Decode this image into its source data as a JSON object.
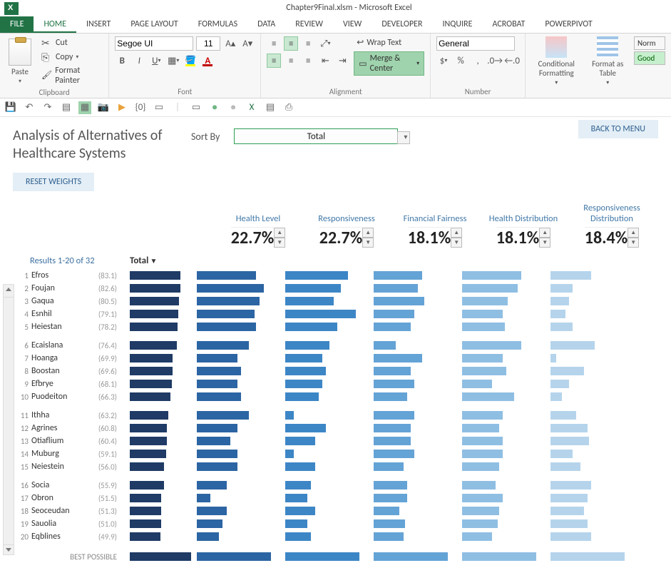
{
  "app": {
    "title": "Chapter9Final.xlsm - Microsoft Excel"
  },
  "tabs": {
    "file": "FILE",
    "home": "HOME",
    "insert": "INSERT",
    "page_layout": "PAGE LAYOUT",
    "formulas": "FORMULAS",
    "data": "DATA",
    "review": "REVIEW",
    "view": "VIEW",
    "developer": "DEVELOPER",
    "inquire": "INQUIRE",
    "acrobat": "ACROBAT",
    "powerpivot": "POWERPIVOT"
  },
  "ribbon": {
    "clipboard": {
      "paste": "Paste",
      "cut": "Cut",
      "copy": "Copy",
      "format_painter": "Format Painter",
      "label": "Clipboard"
    },
    "font": {
      "name": "Segoe UI",
      "size": "11",
      "label": "Font"
    },
    "alignment": {
      "wrap": "Wrap Text",
      "merge": "Merge & Center",
      "label": "Alignment"
    },
    "number": {
      "format": "General",
      "label": "Number"
    },
    "styles": {
      "cond": "Conditional Formatting",
      "table": "Format as Table",
      "norm": "Norm",
      "good": "Good"
    }
  },
  "sheet": {
    "title_l1": "Analysis of Alternatives of",
    "title_l2": "Healthcare Systems",
    "sort_label": "Sort By",
    "sort_value": "Total",
    "back": "BACK TO MENU",
    "reset": "RESET WEIGHTS",
    "results_label": "Results 1-20 of 32",
    "total_label": "Total",
    "best": "BEST POSSIBLE"
  },
  "criteria": [
    {
      "name": "Health Level",
      "weight": "22.7%"
    },
    {
      "name": "Responsiveness",
      "weight": "22.7%"
    },
    {
      "name": "Financial Fairness",
      "weight": "18.1%"
    },
    {
      "name": "Health Distribution",
      "weight": "18.1%"
    },
    {
      "name": "Responsiveness Distribution",
      "weight": "18.4%"
    }
  ],
  "chart_data": {
    "type": "bar",
    "note": "Horizontal bars per alternative. 'total' is overall score; c1..c5 are relative bar lengths (0-100) for the five criteria columns as read from chart.",
    "criteria": [
      "Health Level",
      "Responsiveness",
      "Financial Fairness",
      "Health Distribution",
      "Responsiveness Distribution"
    ],
    "best_possible": {
      "total": 100,
      "c": [
        100,
        100,
        100,
        100,
        100
      ]
    },
    "rows": [
      {
        "rank": 1,
        "name": "Efros",
        "total": 83.1,
        "c": [
          80,
          85,
          65,
          80,
          55
        ]
      },
      {
        "rank": 2,
        "name": "Foujan",
        "total": 82.6,
        "c": [
          90,
          75,
          60,
          75,
          30
        ]
      },
      {
        "rank": 3,
        "name": "Gaqua",
        "total": 80.5,
        "c": [
          85,
          65,
          68,
          62,
          25
        ]
      },
      {
        "rank": 4,
        "name": "Esnhil",
        "total": 79.1,
        "c": [
          78,
          95,
          55,
          55,
          20
        ]
      },
      {
        "rank": 5,
        "name": "Heiestan",
        "total": 78.2,
        "c": [
          80,
          70,
          50,
          58,
          30
        ]
      },
      {
        "rank": 6,
        "name": "Ecaislana",
        "total": 76.4,
        "c": [
          70,
          60,
          30,
          80,
          60
        ]
      },
      {
        "rank": 7,
        "name": "Hoanga",
        "total": 69.9,
        "c": [
          55,
          50,
          65,
          55,
          8
        ]
      },
      {
        "rank": 8,
        "name": "Boostan",
        "total": 69.6,
        "c": [
          60,
          55,
          50,
          60,
          45
        ]
      },
      {
        "rank": 9,
        "name": "Efbrye",
        "total": 68.1,
        "c": [
          55,
          50,
          55,
          40,
          25
        ]
      },
      {
        "rank": 10,
        "name": "Puodeiton",
        "total": 66.3,
        "c": [
          60,
          45,
          45,
          70,
          15
        ]
      },
      {
        "rank": 11,
        "name": "Ithha",
        "total": 63.2,
        "c": [
          70,
          12,
          55,
          55,
          35
        ]
      },
      {
        "rank": 12,
        "name": "Agrines",
        "total": 60.8,
        "c": [
          55,
          55,
          50,
          50,
          50
        ]
      },
      {
        "rank": 13,
        "name": "Otiaflium",
        "total": 60.4,
        "c": [
          45,
          40,
          50,
          55,
          52
        ]
      },
      {
        "rank": 14,
        "name": "Muburg",
        "total": 59.1,
        "c": [
          55,
          12,
          55,
          55,
          30
        ]
      },
      {
        "rank": 15,
        "name": "Neiestein",
        "total": 56.0,
        "c": [
          55,
          40,
          40,
          50,
          40
        ]
      },
      {
        "rank": 16,
        "name": "Socia",
        "total": 55.9,
        "c": [
          40,
          35,
          45,
          45,
          55
        ]
      },
      {
        "rank": 17,
        "name": "Obron",
        "total": 51.5,
        "c": [
          18,
          30,
          45,
          55,
          50
        ]
      },
      {
        "rank": 18,
        "name": "Seoceudan",
        "total": 51.3,
        "c": [
          40,
          40,
          35,
          50,
          45
        ]
      },
      {
        "rank": 19,
        "name": "Sauolia",
        "total": 51.0,
        "c": [
          35,
          30,
          42,
          48,
          50
        ]
      },
      {
        "rank": 20,
        "name": "Eqblines",
        "total": 49.9,
        "c": [
          30,
          35,
          40,
          40,
          55
        ]
      }
    ]
  }
}
